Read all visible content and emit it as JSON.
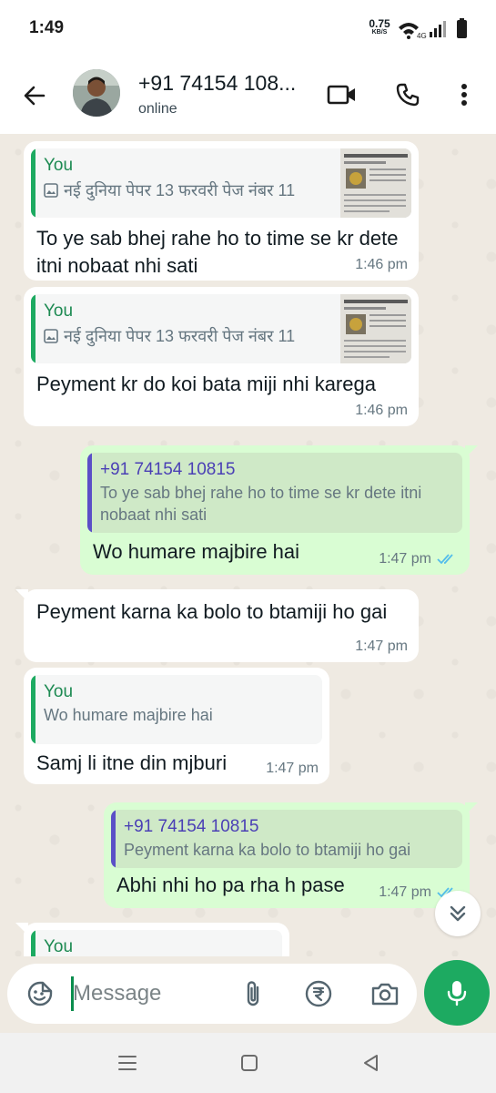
{
  "status_bar": {
    "time": "1:49",
    "net_speed": "0.75",
    "net_speed_unit": "KB/S",
    "network": "4G"
  },
  "header": {
    "contact_name": "+91 74154 108...",
    "contact_status": "online"
  },
  "messages": [
    {
      "direction": "in",
      "quote": {
        "author": "You",
        "text": "नई दुनिया पेपर 13 फरवरी पेज नंबर 11",
        "has_image": true
      },
      "text": "To ye sab bhej rahe ho to time se kr dete itni nobaat nhi sati",
      "time": "1:46 pm"
    },
    {
      "direction": "in",
      "quote": {
        "author": "You",
        "text": "नई दुनिया पेपर 13 फरवरी पेज नंबर 11",
        "has_image": true
      },
      "text": "Peyment kr do koi bata miji nhi karega",
      "time": "1:46 pm"
    },
    {
      "direction": "out",
      "quote": {
        "author": "+91 74154 10815",
        "text": "To ye sab bhej rahe ho to time se kr dete itni nobaat nhi sati"
      },
      "text": "Wo humare majbire hai",
      "time": "1:47 pm",
      "read": true
    },
    {
      "direction": "in",
      "text": "Peyment karna ka bolo to btamiji ho gai",
      "time": "1:47 pm"
    },
    {
      "direction": "in",
      "quote": {
        "author": "You",
        "text": "Wo humare majbire hai"
      },
      "text": "Samj li itne din mjburi",
      "time": "1:47 pm"
    },
    {
      "direction": "out",
      "quote": {
        "author": "+91 74154 10815",
        "text": "Peyment karna ka bolo to btamiji ho gai"
      },
      "text": "Abhi nhi ho pa rha h pase",
      "time": "1:47 pm",
      "read": true
    },
    {
      "direction": "in",
      "quote": {
        "author": "You"
      }
    }
  ],
  "composer": {
    "placeholder": "Message"
  },
  "colors": {
    "accent_green": "#1daa61",
    "incoming_bubble": "#ffffff",
    "outgoing_bubble": "#d9fdd3",
    "quote_you": "#1daa61",
    "quote_other": "#5b4fc7",
    "read_ticks": "#53bdeb",
    "chat_background": "#efeae2"
  },
  "icons": {
    "back": "arrow-left-icon",
    "video": "video-call-icon",
    "call": "phone-icon",
    "menu": "more-vert-icon",
    "sticker": "sticker-icon",
    "attach": "paperclip-icon",
    "payment": "rupee-icon",
    "camera": "camera-icon",
    "mic": "mic-icon",
    "scroll_down": "double-chevron-down-icon",
    "photo": "image-icon"
  }
}
